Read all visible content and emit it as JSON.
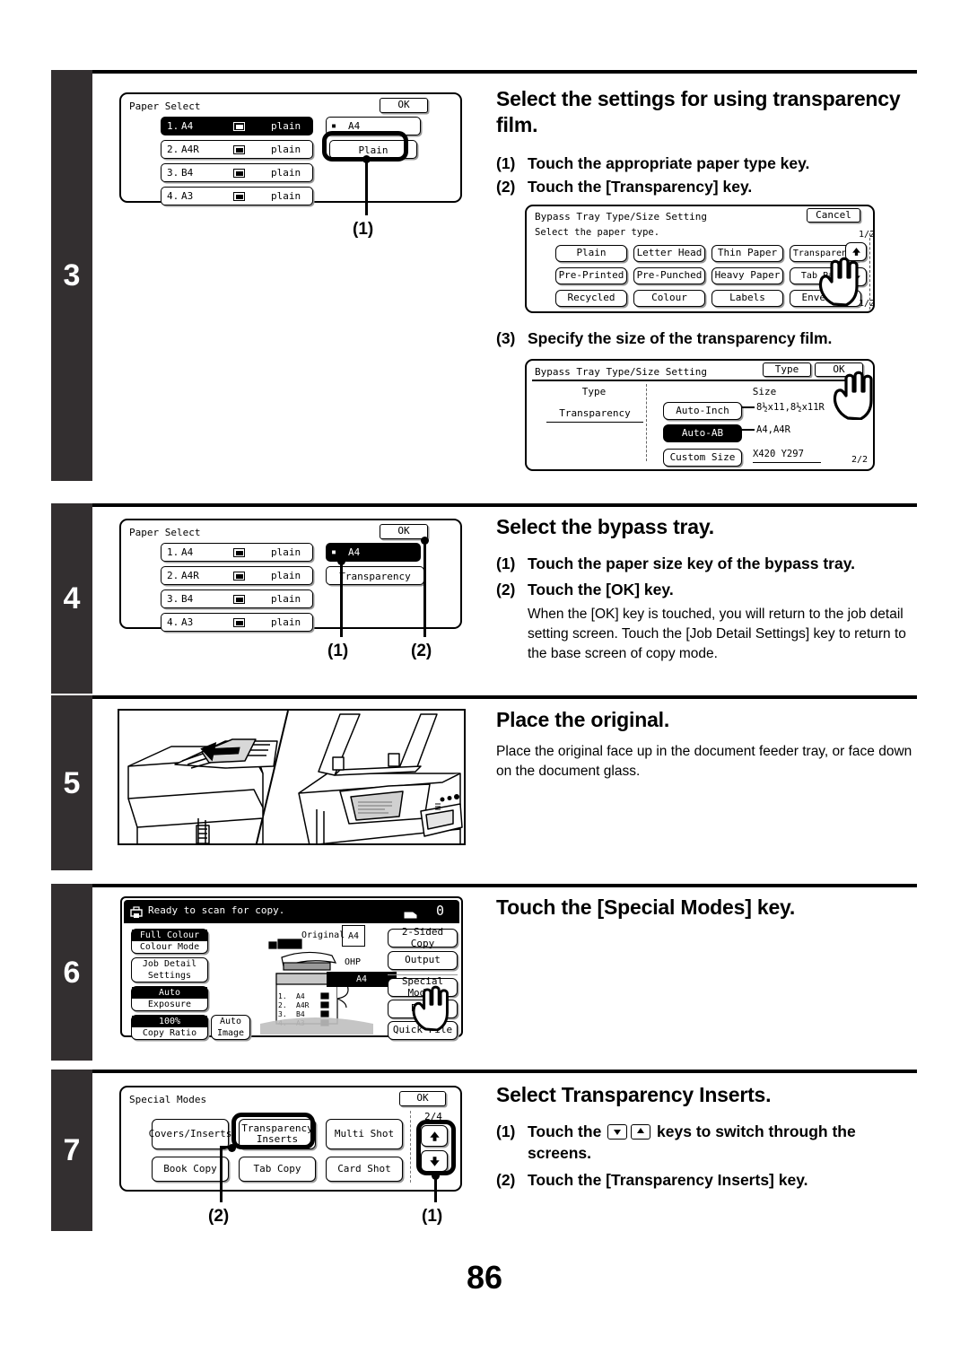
{
  "page": {
    "number": "86"
  },
  "steps": [
    {
      "num": "3",
      "heading": "Select the settings for using transparency film.",
      "items": [
        {
          "marker": "(1)",
          "text": "Touch the appropriate paper type key."
        },
        {
          "marker": "(2)",
          "text": "Touch the [Transparency] key."
        },
        {
          "marker": "(3)",
          "text": "Specify the size of the transparency film."
        }
      ],
      "callouts": [
        "(1)"
      ],
      "paper_select": {
        "title": "Paper Select",
        "ok_label": "OK",
        "rows": [
          {
            "num": "1.",
            "size": "A4",
            "type": "plain",
            "selected": true
          },
          {
            "num": "2.",
            "size": "A4R",
            "type": "plain",
            "selected": false
          },
          {
            "num": "3.",
            "size": "B4",
            "type": "plain",
            "selected": false
          },
          {
            "num": "4.",
            "size": "A3",
            "type": "plain",
            "selected": false
          }
        ],
        "bypass_size": "A4",
        "bypass_type": "Plain"
      },
      "type_screen": {
        "title": "Bypass Tray Type/Size Setting",
        "cancel_label": "Cancel",
        "prompt": "Select the paper type.",
        "page_top": "1/2",
        "page_bottom": "1/2",
        "keys": [
          "Plain",
          "Letter Head",
          "Thin Paper",
          "Transparency",
          "Pre-Printed",
          "Pre-Punched",
          "Heavy Paper",
          "Tab Paper",
          "Recycled",
          "Colour",
          "Labels",
          "Envelope"
        ]
      },
      "size_screen": {
        "title": "Bypass Tray Type/Size Setting",
        "type_label": "Type",
        "ok_label": "OK",
        "col_type": "Type",
        "col_size": "Size",
        "type_value": "Transparency",
        "page": "2/2",
        "rows": [
          {
            "key": "Auto-Inch",
            "value": "8½x11,8½x11R",
            "selected": false
          },
          {
            "key": "Auto-AB",
            "value": "A4,A4R",
            "selected": true
          },
          {
            "key": "Custom Size",
            "value": "X420 Y297",
            "selected": false
          }
        ]
      }
    },
    {
      "num": "4",
      "heading": "Select the bypass tray.",
      "items": [
        {
          "marker": "(1)",
          "text": "Touch the paper size key of the bypass tray."
        },
        {
          "marker": "(2)",
          "text": "Touch the  [OK] key."
        }
      ],
      "note": "When the [OK] key is touched, you will return to the job detail setting screen. Touch the [Job Detail Settings] key to return to the base screen of copy mode.",
      "callouts": [
        "(1)",
        "(2)"
      ],
      "paper_select": {
        "title": "Paper Select",
        "ok_label": "OK",
        "rows": [
          {
            "num": "1.",
            "size": "A4",
            "type": "plain",
            "selected": false
          },
          {
            "num": "2.",
            "size": "A4R",
            "type": "plain",
            "selected": false
          },
          {
            "num": "3.",
            "size": "B4",
            "type": "plain",
            "selected": false
          },
          {
            "num": "4.",
            "size": "A3",
            "type": "plain",
            "selected": false
          }
        ],
        "bypass_size": "A4",
        "bypass_type": "Transparency"
      }
    },
    {
      "num": "5",
      "heading": "Place the original.",
      "note": "Place the original face up in the document feeder tray, or face down on the document glass.",
      "illustration": "copier-document-feeder-and-glass-illustration"
    },
    {
      "num": "6",
      "heading": "Touch the [Special Modes] key.",
      "base_screen": {
        "status": "Ready to scan for copy.",
        "counter": "0",
        "left_keys": [
          {
            "top": "Full Colour",
            "bottom": "Colour Mode",
            "top_selected": true
          },
          {
            "top": "Job Detail",
            "bottom": "Settings",
            "top_selected": false
          },
          {
            "top": "Auto",
            "bottom": "Exposure",
            "top_selected": true
          },
          {
            "top": "100%",
            "bottom": "Copy Ratio",
            "top_selected": true
          }
        ],
        "auto_image": {
          "top": "Auto",
          "bottom": "Image"
        },
        "original_label": "Original",
        "original_size": "A4",
        "ohp_label": "OHP",
        "ohp_size": "A4",
        "tray_rows": [
          {
            "num": "1.",
            "size": "A4"
          },
          {
            "num": "2.",
            "size": "A4R"
          },
          {
            "num": "3.",
            "size": "B4"
          },
          {
            "num": "4.",
            "size": "A3"
          }
        ],
        "right_keys": [
          "2-Sided Copy",
          "Output",
          "Special Modes",
          "File",
          "Quick File"
        ]
      }
    },
    {
      "num": "7",
      "heading": "Select Transparency Inserts.",
      "items": [
        {
          "marker": "(1)",
          "text_before": "Touch the ",
          "text_after": " keys to switch through the screens."
        },
        {
          "marker": "(2)",
          "text": "Touch the [Transparency Inserts] key."
        }
      ],
      "callouts": [
        "(2)",
        "(1)"
      ],
      "special_modes": {
        "title": "Special Modes",
        "ok_label": "OK",
        "page": "2/4",
        "keys": [
          {
            "line1": "Covers/Inserts",
            "line2": ""
          },
          {
            "line1": "Transparency",
            "line2": "Inserts"
          },
          {
            "line1": "Multi Shot",
            "line2": ""
          },
          {
            "line1": "Book Copy",
            "line2": ""
          },
          {
            "line1": "Tab Copy",
            "line2": ""
          },
          {
            "line1": "Card Shot",
            "line2": ""
          }
        ]
      }
    }
  ],
  "icons": {
    "tray": "tray-icon",
    "bypass": "bypass-tray-icon",
    "status": "printer-status-icon",
    "output": "output-tray-icon",
    "up_arrow": "arrow-up-icon",
    "down_arrow": "arrow-down-icon",
    "hand": "pointing-hand-cursor"
  }
}
